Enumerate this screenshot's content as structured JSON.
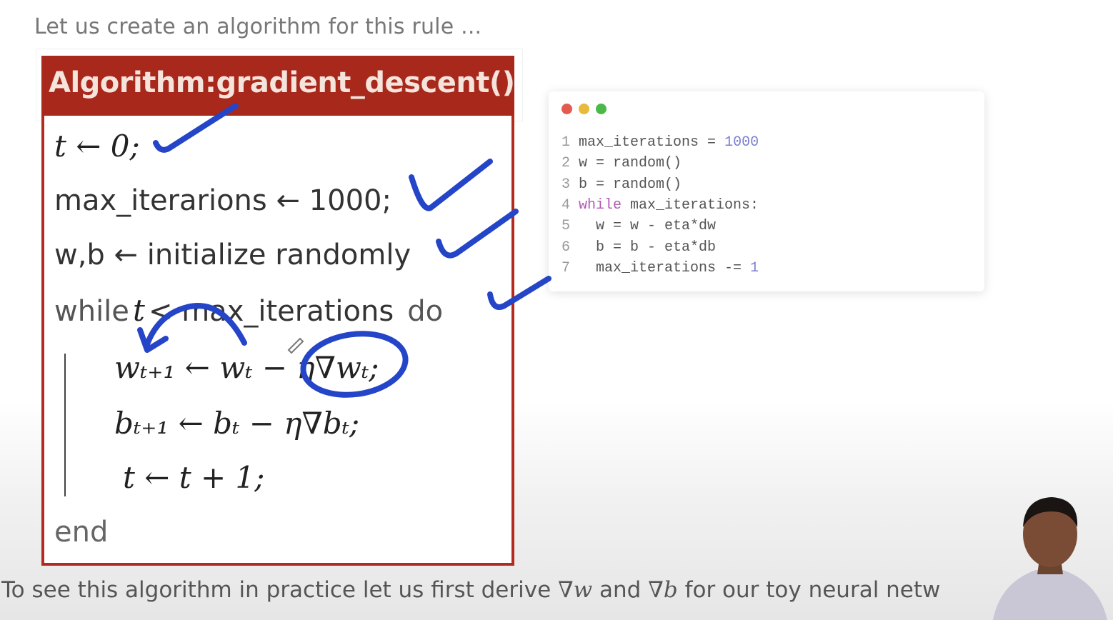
{
  "intro_text": "Let us create an algorithm for this rule ...",
  "algorithm": {
    "title": "Algorithm:gradient_descent()",
    "line_t_init": "t ← 0;",
    "line_max_iter": "max_iterarions ← 1000;",
    "line_init_wb": "w,b ← initialize randomly",
    "line_while_kw": "while",
    "line_while_var": "t",
    "line_while_rest": "< max_iterations",
    "line_while_do": "do",
    "line_update_w": "wₜ₊₁ ← wₜ − η∇wₜ;",
    "line_update_b": "bₜ₊₁ ← bₜ − η∇bₜ;",
    "line_increment_t": "t ← t + 1;",
    "line_end": "end"
  },
  "code_window": {
    "dot_colors": [
      "#e35b4f",
      "#e8b93a",
      "#4bb84a"
    ],
    "lines": [
      {
        "num": "1",
        "pre": "max_iterations = ",
        "kw": "",
        "post": "",
        "numval": "1000"
      },
      {
        "num": "2",
        "pre": "w = random()",
        "kw": "",
        "post": "",
        "numval": ""
      },
      {
        "num": "3",
        "pre": "b = random()",
        "kw": "",
        "post": "",
        "numval": ""
      },
      {
        "num": "4",
        "pre": "",
        "kw": "while",
        "post": " max_iterations:",
        "numval": ""
      },
      {
        "num": "5",
        "pre": "  w = w - eta*dw",
        "kw": "",
        "post": "",
        "numval": ""
      },
      {
        "num": "6",
        "pre": "  b = b - eta*db",
        "kw": "",
        "post": "",
        "numval": ""
      },
      {
        "num": "7",
        "pre": "  max_iterations -= ",
        "kw": "",
        "post": "",
        "numval": "1"
      }
    ]
  },
  "footer": {
    "part1": "To see this algorithm in practice let us first derive ",
    "grad_w": "∇w",
    "part2": " and ",
    "grad_b": "∇b",
    "part3": "  for our toy neural netw"
  },
  "colors": {
    "header_red": "#a9281c",
    "border_red": "#b42a1e",
    "ink_blue": "#2445c8"
  }
}
